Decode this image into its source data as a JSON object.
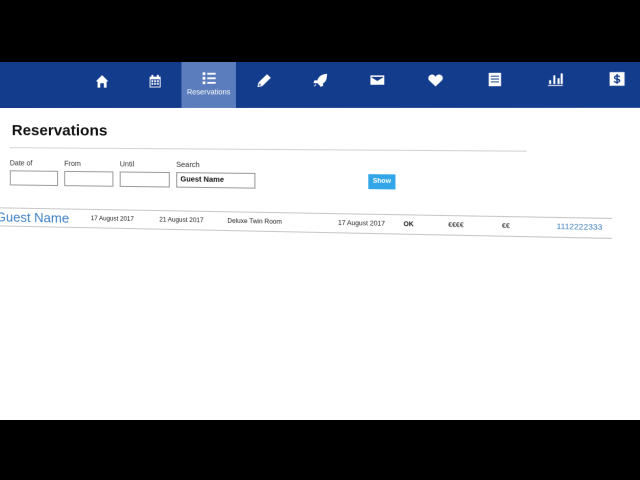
{
  "nav": {
    "items": [
      {
        "icon": "home-icon",
        "label": ""
      },
      {
        "icon": "calendar-icon",
        "label": ""
      },
      {
        "icon": "list-icon",
        "label": "Reservations",
        "active": true
      },
      {
        "icon": "pencil-icon",
        "label": ""
      },
      {
        "icon": "rocket-icon",
        "label": ""
      },
      {
        "icon": "envelope-icon",
        "label": ""
      },
      {
        "icon": "heart-icon",
        "label": ""
      },
      {
        "icon": "document-icon",
        "label": ""
      },
      {
        "icon": "bar-chart-icon",
        "label": ""
      },
      {
        "icon": "dollar-icon",
        "label": ""
      }
    ]
  },
  "page": {
    "title": "Reservations"
  },
  "filters": {
    "date_of_label": "Date of",
    "from_label": "From",
    "until_label": "Until",
    "search_label": "Search",
    "date_of_value": "",
    "from_value": "",
    "until_value": "",
    "search_value": "Guest Name",
    "show_label": "Show"
  },
  "reservations": [
    {
      "guest": "Guest Name",
      "from": "17 August 2017",
      "until": "21 August 2017",
      "room": "Deluxe Twin Room",
      "booked": "17 August 2017",
      "status": "OK",
      "price": "€€€€",
      "tier": "€€",
      "phone": "1112222333"
    }
  ],
  "colors": {
    "nav_bg": "#143c8c",
    "nav_active": "#5b7dbd",
    "link": "#3d7fc3",
    "show_button": "#32a6e8",
    "backdrop": "#4f72b0"
  }
}
